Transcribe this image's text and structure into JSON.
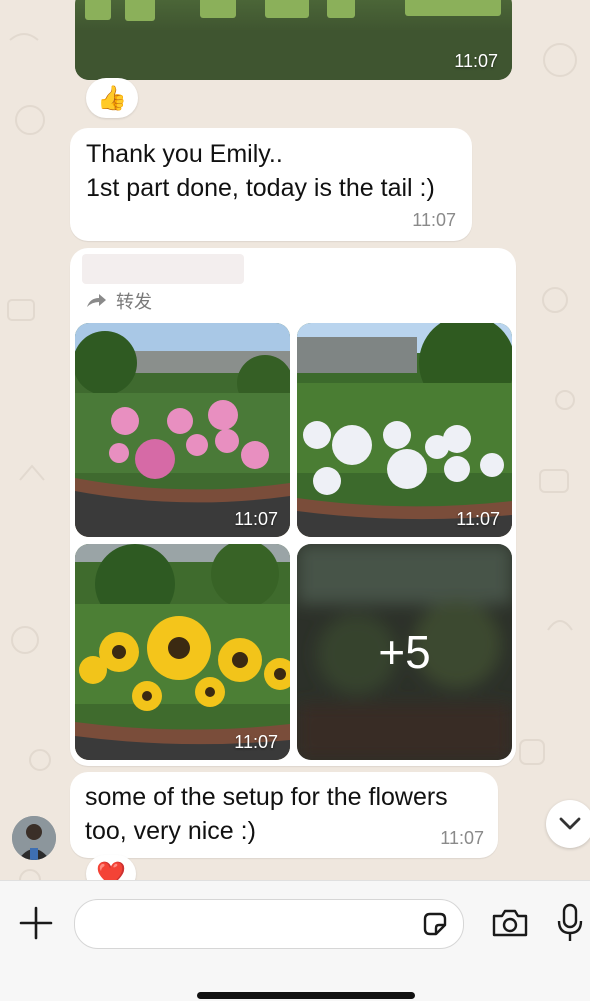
{
  "messages": {
    "top_image": {
      "time": "11:07",
      "reaction": "👍"
    },
    "thank_you": {
      "line1": "Thank you Emily..",
      "line2": "1st part done, today is the tail :)",
      "time": "11:07"
    },
    "forwarded": {
      "forwarded_label": "转发",
      "photos": [
        {
          "time": "11:07",
          "description": "pink flowers"
        },
        {
          "time": "11:07",
          "description": "white flowers"
        },
        {
          "time": "11:07",
          "description": "sunflowers"
        },
        {
          "more_count": "+5"
        }
      ]
    },
    "setup": {
      "line1": "some of the setup for the flowers",
      "line2": "too, very nice :)",
      "time": "11:07",
      "reaction": "❤️"
    }
  },
  "composer": {
    "input_value": "",
    "icons": [
      "plus-icon",
      "sticker-icon",
      "camera-icon",
      "microphone-icon"
    ]
  },
  "scroll_button_icon": "chevron-down-icon",
  "colors": {
    "background": "#efe7de",
    "bubble": "#ffffff",
    "time": "#8a8a8a"
  }
}
